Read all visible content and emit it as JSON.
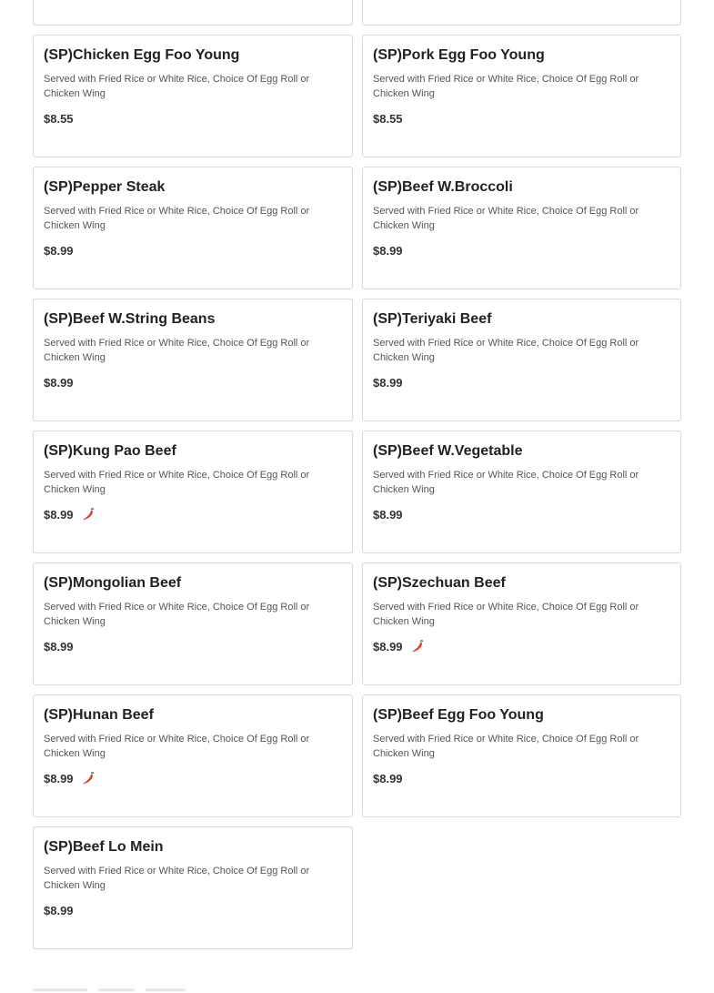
{
  "menu": {
    "description_text": "Served with Fried Rice or White Rice, Choice Of Egg Roll or Chicken Wing",
    "spicy_icon": "chili-pepper-icon",
    "spicy_color": "#e0382b",
    "items": [
      {
        "name": "",
        "price": "",
        "spicy": false
      },
      {
        "name": "",
        "price": "",
        "spicy": false
      },
      {
        "name": "(SP)Chicken Egg Foo Young",
        "price": "$8.55",
        "spicy": false
      },
      {
        "name": "(SP)Pork Egg Foo Young",
        "price": "$8.55",
        "spicy": false
      },
      {
        "name": "(SP)Pepper Steak",
        "price": "$8.99",
        "spicy": false
      },
      {
        "name": "(SP)Beef W.Broccoli",
        "price": "$8.99",
        "spicy": false
      },
      {
        "name": "(SP)Beef W.String Beans",
        "price": "$8.99",
        "spicy": false
      },
      {
        "name": "(SP)Teriyaki Beef",
        "price": "$8.99",
        "spicy": false
      },
      {
        "name": "(SP)Kung Pao Beef",
        "price": "$8.99",
        "spicy": true
      },
      {
        "name": "(SP)Beef W.Vegetable",
        "price": "$8.99",
        "spicy": false
      },
      {
        "name": "(SP)Mongolian Beef",
        "price": "$8.99",
        "spicy": false
      },
      {
        "name": "(SP)Szechuan Beef",
        "price": "$8.99",
        "spicy": true
      },
      {
        "name": "(SP)Hunan Beef",
        "price": "$8.99",
        "spicy": true
      },
      {
        "name": "(SP)Beef Egg Foo Young",
        "price": "$8.99",
        "spicy": false
      },
      {
        "name": "(SP)Beef Lo Mein",
        "price": "$8.99",
        "spicy": false
      }
    ]
  }
}
